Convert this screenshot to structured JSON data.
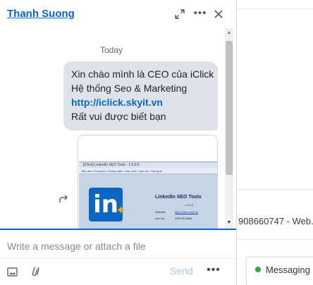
{
  "background": {
    "snippet_text": "908660747 - Web...",
    "messaging_label": "Messaging"
  },
  "chat": {
    "contact_name": "Thanh Suong",
    "header_icons": [
      "expand-icon",
      "more-icon",
      "close-icon"
    ],
    "date_separator": "Today",
    "message": {
      "lines": [
        "Xin chào mình là CEO của iClick",
        "Hệ thống Seo & Marketing"
      ],
      "link": "http://iclick.skyit.vn",
      "closing": "Rất vui được biết bạn"
    },
    "attachment": {
      "window_title": "[iClick] LinkedIn SEO Tools - 1.0.9.0",
      "tabs": "Bài viết ▪ Thông tin ▪ Hướng dẫn ▪ Cấu hình ▪ Liên hệ ▪ Thông tin",
      "product_name": "LinkedIn SEO Tools",
      "version": "1.0.9.0",
      "website_label": "Website:",
      "website_value": "http://iclick.skyit.vn",
      "contact_label": "Liên hệ:",
      "contact_value": "0909 82 6364"
    },
    "compose_placeholder": "Write a message or attach a file",
    "send_label": "Send"
  },
  "colors": {
    "accent": "#0a66c2",
    "bubble": "#dde3e9",
    "online": "#3ea33b"
  }
}
